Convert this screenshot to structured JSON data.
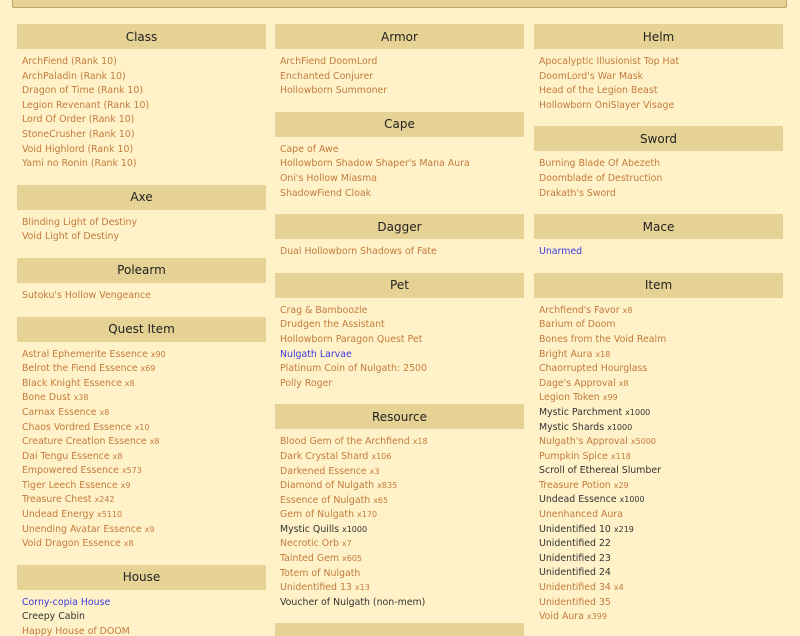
{
  "columns": [
    [
      {
        "title": "Class",
        "items": [
          {
            "name": "ArchFiend (Rank 10)",
            "color": "orange"
          },
          {
            "name": "ArchPaladin (Rank 10)",
            "color": "orange"
          },
          {
            "name": "Dragon of Time (Rank 10)",
            "color": "orange"
          },
          {
            "name": "Legion Revenant (Rank 10)",
            "color": "orange"
          },
          {
            "name": "Lord Of Order (Rank 10)",
            "color": "orange"
          },
          {
            "name": "StoneCrusher (Rank 10)",
            "color": "orange"
          },
          {
            "name": "Void Highlord (Rank 10)",
            "color": "orange"
          },
          {
            "name": "Yami no Ronin (Rank 10)",
            "color": "orange"
          }
        ]
      },
      {
        "title": "Axe",
        "items": [
          {
            "name": "Blinding Light of Destiny",
            "color": "orange"
          },
          {
            "name": "Void Light of Destiny",
            "color": "orange"
          }
        ]
      },
      {
        "title": "Polearm",
        "items": [
          {
            "name": "Sutoku's Hollow Vengeance",
            "color": "orange"
          }
        ]
      },
      {
        "title": "Quest Item",
        "items": [
          {
            "name": "Astral Ephemerite Essence",
            "qty": "x90",
            "color": "orange"
          },
          {
            "name": "Belrot the Fiend Essence",
            "qty": "x69",
            "color": "orange"
          },
          {
            "name": "Black Knight Essence",
            "qty": "x8",
            "color": "orange"
          },
          {
            "name": "Bone Dust",
            "qty": "x38",
            "color": "orange"
          },
          {
            "name": "Carnax Essence",
            "qty": "x8",
            "color": "orange"
          },
          {
            "name": "Chaos Vordred Essence",
            "qty": "x10",
            "color": "orange"
          },
          {
            "name": "Creature Creation Essence",
            "qty": "x8",
            "color": "orange"
          },
          {
            "name": "Dai Tengu Essence",
            "qty": "x8",
            "color": "orange"
          },
          {
            "name": "Empowered Essence",
            "qty": "x573",
            "color": "orange"
          },
          {
            "name": "Tiger Leech Essence",
            "qty": "x9",
            "color": "orange"
          },
          {
            "name": "Treasure Chest",
            "qty": "x242",
            "color": "orange"
          },
          {
            "name": "Undead Energy",
            "qty": "x5110",
            "color": "orange"
          },
          {
            "name": "Unending Avatar Essence",
            "qty": "x9",
            "color": "orange"
          },
          {
            "name": "Void Dragon Essence",
            "qty": "x8",
            "color": "orange"
          }
        ]
      },
      {
        "title": "House",
        "items": [
          {
            "name": "Corny-copia House",
            "color": "blue"
          },
          {
            "name": "Creepy Cabin",
            "color": "dark"
          },
          {
            "name": "Happy House of DOOM",
            "color": "orange"
          }
        ]
      }
    ],
    [
      {
        "title": "Armor",
        "items": [
          {
            "name": "ArchFiend DoomLord",
            "color": "orange"
          },
          {
            "name": "Enchanted Conjurer",
            "color": "orange"
          },
          {
            "name": "Hollowborn Summoner",
            "color": "orange"
          }
        ]
      },
      {
        "title": "Cape",
        "items": [
          {
            "name": "Cape of Awe",
            "color": "orange"
          },
          {
            "name": "Hollowborn Shadow Shaper's Mana Aura",
            "color": "orange"
          },
          {
            "name": "Oni's Hollow Miasma",
            "color": "orange"
          },
          {
            "name": "ShadowFiend Cloak",
            "color": "orange"
          }
        ]
      },
      {
        "title": "Dagger",
        "items": [
          {
            "name": "Dual Hollowborn Shadows of Fate",
            "color": "orange"
          }
        ]
      },
      {
        "title": "Pet",
        "items": [
          {
            "name": "Crag & Bamboozle",
            "color": "orange"
          },
          {
            "name": "Drudgen the Assistant",
            "color": "orange"
          },
          {
            "name": "Hollowborn Paragon Quest Pet",
            "color": "orange"
          },
          {
            "name": "Nulgath Larvae",
            "color": "blue"
          },
          {
            "name": "Platinum Coin of Nulgath: 2500",
            "color": "orange"
          },
          {
            "name": "Polly Roger",
            "color": "orange"
          }
        ]
      },
      {
        "title": "Resource",
        "items": [
          {
            "name": "Blood Gem of the Archfiend",
            "qty": "x18",
            "color": "orange"
          },
          {
            "name": "Dark Crystal Shard",
            "qty": "x106",
            "color": "orange"
          },
          {
            "name": "Darkened Essence",
            "qty": "x3",
            "color": "orange"
          },
          {
            "name": "Diamond of Nulgath",
            "qty": "x835",
            "color": "orange"
          },
          {
            "name": "Essence of Nulgath",
            "qty": "x65",
            "color": "orange"
          },
          {
            "name": "Gem of Nulgath",
            "qty": "x170",
            "color": "orange"
          },
          {
            "name": "Mystic Quills",
            "qty": "x1000",
            "color": "dark"
          },
          {
            "name": "Necrotic Orb",
            "qty": "x7",
            "color": "orange"
          },
          {
            "name": "Tainted Gem",
            "qty": "x605",
            "color": "orange"
          },
          {
            "name": "Totem of Nulgath",
            "color": "orange"
          },
          {
            "name": "Unidentified 13",
            "qty": "x13",
            "color": "orange"
          },
          {
            "name": "Voucher of Nulgath (non-mem)",
            "color": "dark"
          }
        ]
      },
      {
        "title": "",
        "items": []
      }
    ],
    [
      {
        "title": "Helm",
        "items": [
          {
            "name": "Apocalyptic Illusionist Top Hat",
            "color": "orange"
          },
          {
            "name": "DoomLord's War Mask",
            "color": "orange"
          },
          {
            "name": "Head of the Legion Beast",
            "color": "orange"
          },
          {
            "name": "Hollowborn OniSlayer Visage",
            "color": "orange"
          }
        ]
      },
      {
        "title": "Sword",
        "items": [
          {
            "name": "Burning Blade Of Abezeth",
            "color": "orange"
          },
          {
            "name": "Doomblade of Destruction",
            "color": "orange"
          },
          {
            "name": "Drakath's Sword",
            "color": "orange"
          }
        ]
      },
      {
        "title": "Mace",
        "items": [
          {
            "name": "Unarmed",
            "color": "blue"
          }
        ]
      },
      {
        "title": "Item",
        "items": [
          {
            "name": "Archfiend's Favor",
            "qty": "x8",
            "color": "orange"
          },
          {
            "name": "Barium of Doom",
            "color": "orange"
          },
          {
            "name": "Bones from the Void Realm",
            "color": "orange"
          },
          {
            "name": "Bright Aura",
            "qty": "x18",
            "color": "orange"
          },
          {
            "name": "Chaorrupted Hourglass",
            "color": "orange"
          },
          {
            "name": "Dage's Approval",
            "qty": "x8",
            "color": "orange"
          },
          {
            "name": "Legion Token",
            "qty": "x99",
            "color": "orange"
          },
          {
            "name": "Mystic Parchment",
            "qty": "x1000",
            "color": "dark"
          },
          {
            "name": "Mystic Shards",
            "qty": "x1000",
            "color": "dark"
          },
          {
            "name": "Nulgath's Approval",
            "qty": "x5000",
            "color": "orange"
          },
          {
            "name": "Pumpkin Spice",
            "qty": "x118",
            "color": "orange"
          },
          {
            "name": "Scroll of Ethereal Slumber",
            "color": "dark"
          },
          {
            "name": "Treasure Potion",
            "qty": "x29",
            "color": "orange"
          },
          {
            "name": "Undead Essence",
            "qty": "x1000",
            "color": "dark"
          },
          {
            "name": "Unenhanced Aura",
            "color": "orange"
          },
          {
            "name": "Unidentified 10",
            "qty": "x219",
            "color": "dark"
          },
          {
            "name": "Unidentified 22",
            "color": "dark"
          },
          {
            "name": "Unidentified 23",
            "color": "dark"
          },
          {
            "name": "Unidentified 24",
            "color": "dark"
          },
          {
            "name": "Unidentified 34",
            "qty": "x4",
            "color": "orange"
          },
          {
            "name": "Unidentified 35",
            "color": "orange"
          },
          {
            "name": "Void Aura",
            "qty": "x399",
            "color": "orange"
          }
        ]
      }
    ]
  ]
}
